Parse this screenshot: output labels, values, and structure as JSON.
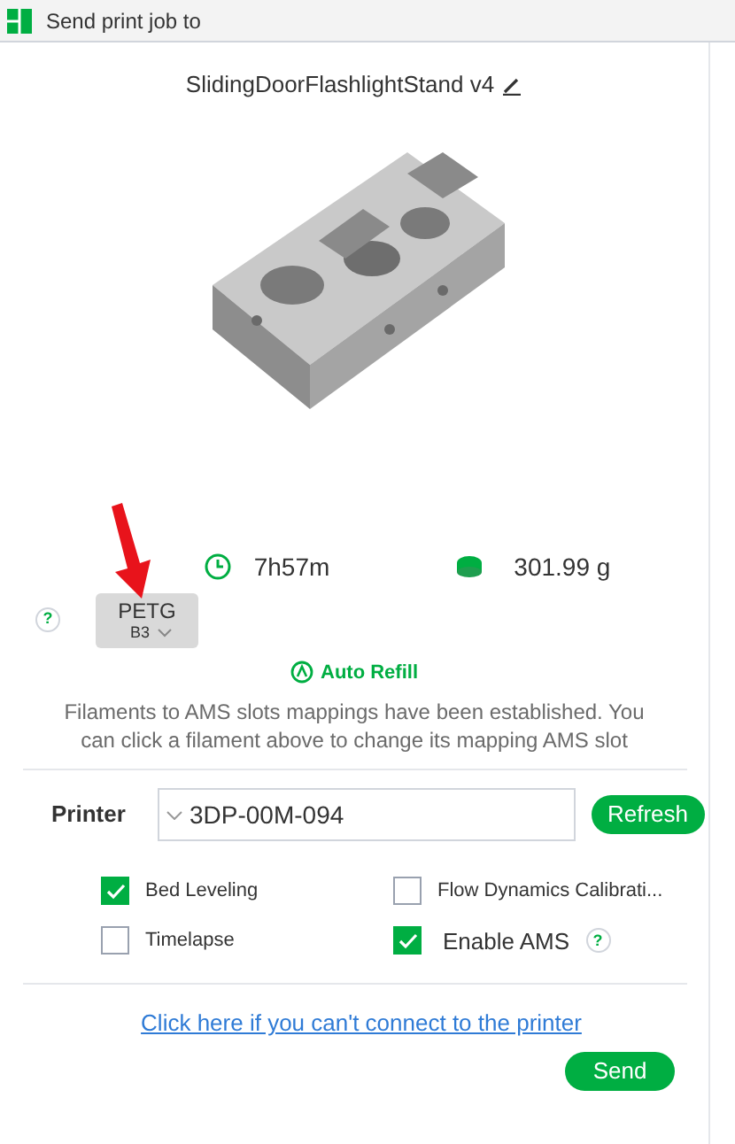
{
  "window": {
    "title": "Send print job to"
  },
  "model": {
    "name": "SlidingDoorFlashlightStand v4"
  },
  "stats": {
    "time": "7h57m",
    "weight": "301.99 g"
  },
  "filament_help": "?",
  "filaments": [
    {
      "material": "PETG",
      "slot": "B3"
    }
  ],
  "auto_refill": "Auto Refill",
  "mapping_note": "Filaments to AMS slots mappings have been established. You can click a filament above to change its mapping AMS slot",
  "printer": {
    "label": "Printer",
    "value": "3DP-00M-094",
    "refresh": "Refresh"
  },
  "options": [
    {
      "label": "Bed Leveling",
      "checked": true
    },
    {
      "label": "Flow Dynamics Calibrati...",
      "checked": false
    },
    {
      "label": "Timelapse",
      "checked": false
    },
    {
      "label": "Enable AMS",
      "checked": true,
      "help": "?"
    }
  ],
  "help_link": "Click here if you can't connect to the printer",
  "send": "Send"
}
